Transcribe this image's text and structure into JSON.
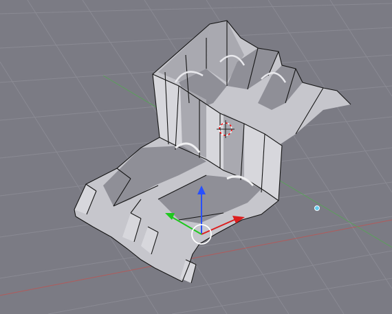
{
  "viewport": {
    "mode": "3D View",
    "background_color": "#7b7b84",
    "grid_color": "#8a8a93",
    "x_axis_color": "#b25a5a",
    "y_axis_color": "#5aa05a"
  },
  "scene": {
    "object": "extruded-mesh",
    "selected": true
  },
  "gizmo": {
    "x_color": "#dc1e1e",
    "y_color": "#1ec81e",
    "z_color": "#2850ff",
    "center_circle_color": "#ffffff"
  },
  "cursor": {
    "color_a": "#ff0000",
    "color_b": "#ffffff"
  },
  "light": {
    "color": "#66ccee"
  }
}
